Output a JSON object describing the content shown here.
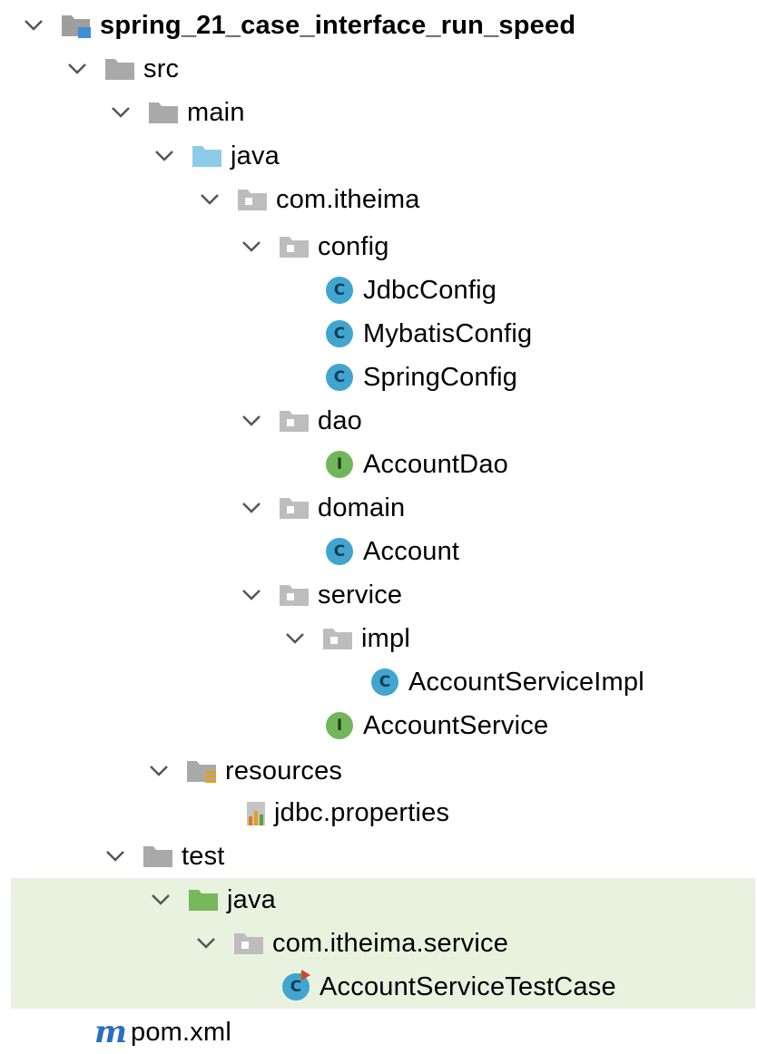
{
  "tree": {
    "project": "spring_21_case_interface_run_speed",
    "src": "src",
    "main": "main",
    "main_java": "java",
    "pkg_main": "com.itheima",
    "config": "config",
    "jdbc_config": "JdbcConfig",
    "mybatis_config": "MybatisConfig",
    "spring_config": "SpringConfig",
    "dao": "dao",
    "account_dao": "AccountDao",
    "domain": "domain",
    "account": "Account",
    "service": "service",
    "impl": "impl",
    "account_service_impl": "AccountServiceImpl",
    "account_service": "AccountService",
    "resources": "resources",
    "jdbc_properties": "jdbc.properties",
    "test": "test",
    "test_java": "java",
    "pkg_test": "com.itheima.service",
    "test_case": "AccountServiceTestCase",
    "pom": "pom.xml"
  },
  "icons": {
    "class_badge": "C",
    "interface_badge": "I",
    "maven_badge": "m"
  },
  "colors": {
    "selected_row_bg": "#e8f2df",
    "source_folder": "#8ccce8",
    "test_folder": "#78b75a",
    "package_folder": "#bdbdbd",
    "class_icon": "#41a5cf",
    "interface_icon": "#72b65c",
    "maven_icon": "#2c6fbf"
  }
}
